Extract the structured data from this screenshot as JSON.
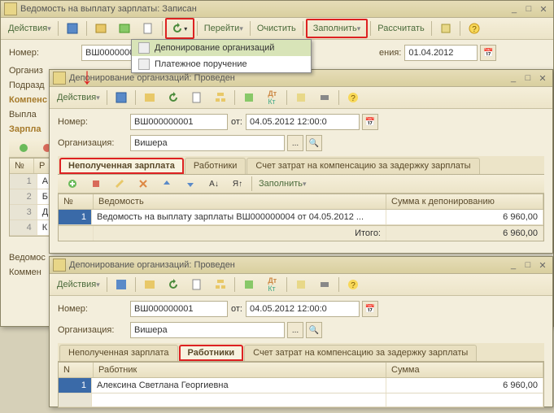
{
  "win1": {
    "title": "Ведомость на выплату зарплаты: Записан",
    "actions": "Действия",
    "menu": {
      "goto": "Перейти",
      "clear": "Очистить",
      "fill": "Заполнить",
      "calc": "Рассчитать"
    },
    "dropdown": {
      "item1": "Депонирование организаций",
      "item2": "Платежное поручение"
    },
    "labels": {
      "number": "Номер:",
      "org": "Организ",
      "dept": "Подразд",
      "comp": "Компенс",
      "payout": "Выпла",
      "salary": "Зарпла",
      "on_label": "ения:",
      "vedom": "Ведомос",
      "comment": "Коммен"
    },
    "values": {
      "number": "ВШ0000000",
      "on_date": "01.04.2012"
    },
    "cells": {
      "r1": "1",
      "r1b": "A",
      "r2": "2",
      "r2b": "Б",
      "r3": "3",
      "r3b": "Д",
      "r4": "4",
      "r4b": "К"
    }
  },
  "win2": {
    "title": "Депонирование организаций: Проведен",
    "actions": "Действия",
    "labels": {
      "number": "Номер:",
      "from": "от:",
      "org": "Организация:"
    },
    "values": {
      "number": "ВШ000000001",
      "date": "04.05.2012 12:00:0",
      "org": "Вишера"
    },
    "tabs": {
      "t1": "Неполученная зарплата",
      "t2": "Работники",
      "t3": "Счет затрат на компенсацию за задержку зарплаты"
    },
    "fill": "Заполнить",
    "grid": {
      "h1": "№",
      "h2": "Ведомость",
      "h3": "Сумма к депонированию",
      "r1n": "1",
      "r1v": "Ведомость на выплату зарплаты ВШ000000004 от 04.05.2012 ...",
      "r1s": "6 960,00",
      "total": "Итого:",
      "totalv": "6 960,00"
    }
  },
  "win3": {
    "title": "Депонирование организаций: Проведен",
    "actions": "Действия",
    "labels": {
      "number": "Номер:",
      "from": "от:",
      "org": "Организация:"
    },
    "values": {
      "number": "ВШ000000001",
      "date": "04.05.2012 12:00:0",
      "org": "Вишера"
    },
    "tabs": {
      "t1": "Неполученная зарплата",
      "t2": "Работники",
      "t3": "Счет затрат на компенсацию за задержку зарплаты"
    },
    "grid": {
      "h1": "N",
      "h2": "Работник",
      "h3": "Сумма",
      "r1n": "1",
      "r1v": "Алексина Светлана Георгиевна",
      "r1s": "6 960,00"
    }
  }
}
